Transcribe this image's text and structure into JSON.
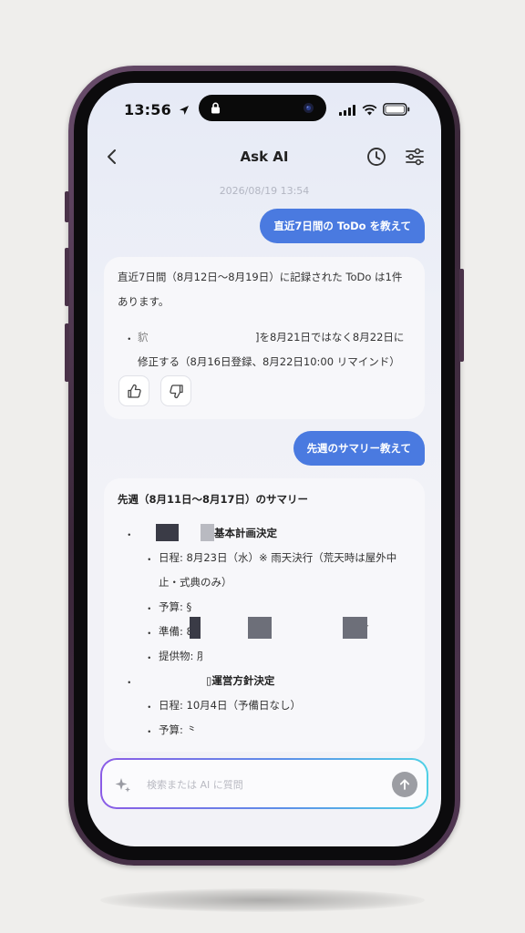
{
  "status_bar": {
    "time": "13:56"
  },
  "nav": {
    "title": "Ask AI"
  },
  "chat": {
    "timestamp": "2026/08/19 13:54",
    "user_msg_1": "直近7日間の ToDo を教えて",
    "reply_1": {
      "line1": "直近7日間（8月12日〜8月19日）に記録された ToDo は1件",
      "line2": "あります。",
      "item_prefix": "・",
      "item_line1_start": "貁",
      "item_line1_end": "]を8月21日ではなく8月22日に",
      "item_line2": "修正する（8月16日登録、8月22日10:00 リマインド）"
    },
    "user_msg_2": "先週のサマリー教えて",
    "reply_2": {
      "heading": "先週（8月11日〜8月17日）のサマリー",
      "bullet_top": "・",
      "sub_bullet": "・",
      "section1_title": "基本計画決定",
      "s1_schedule_line1": "日程: 8月23日（水）※ 雨天決行（荒天時は屋外中",
      "s1_schedule_line2": "止・式典のみ）",
      "s1_budget": "予算: §",
      "s1_prep": "準備: 8",
      "s1_prep_tail": "・",
      "s1_supply": "提供物: ⺼",
      "section2_title": "▯運営方針決定",
      "s2_schedule": "日程: 10月4日（予備日なし）",
      "s2_budget": "予算: ⺀"
    }
  },
  "input": {
    "placeholder": "検索または AI に質問"
  },
  "colors": {
    "user_bubble": "#4a7ae0",
    "input_gradient_start": "#8b5ce6",
    "input_gradient_end": "#4fd0e6",
    "frame": "#4f3651"
  },
  "icons": [
    "back-chevron-icon",
    "clock-icon",
    "sliders-icon",
    "thumbs-up-icon",
    "thumbs-down-icon",
    "sparkle-icon",
    "arrow-up-icon",
    "location-arrow-icon",
    "lock-icon",
    "camera-icon",
    "signal-icon",
    "wifi-icon",
    "battery-icon"
  ]
}
